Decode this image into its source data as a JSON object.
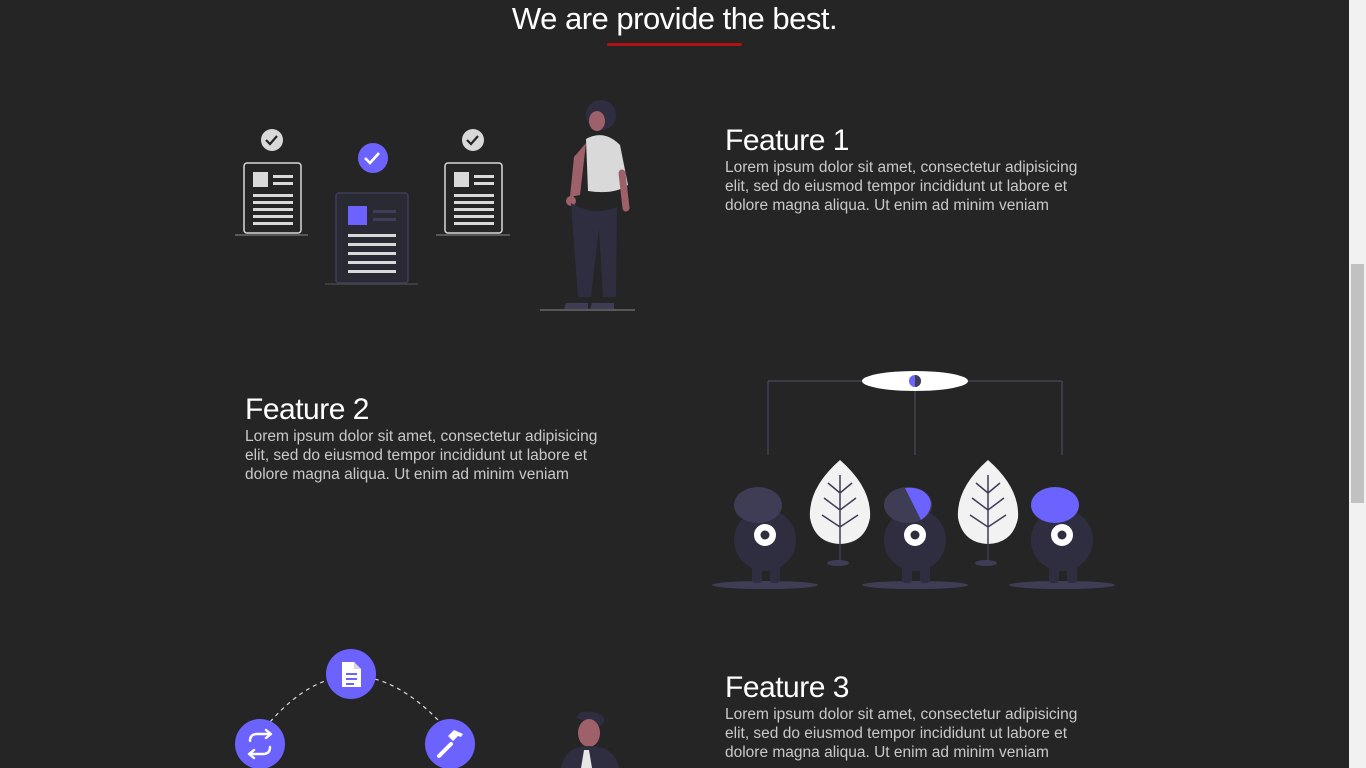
{
  "section": {
    "title": "We are provide the best."
  },
  "features": [
    {
      "title": "Feature 1",
      "body": "Lorem ipsum dolor sit amet, consectetur adipisicing elit, sed do eiusmod tempor incididunt ut labore et dolore magna aliqua. Ut enim ad minim veniam"
    },
    {
      "title": "Feature 2",
      "body": "Lorem ipsum dolor sit amet, consectetur adipisicing elit, sed do eiusmod tempor incididunt ut labore et dolore magna aliqua. Ut enim ad minim veniam"
    },
    {
      "title": "Feature 3",
      "body": "Lorem ipsum dolor sit amet, consectetur adipisicing elit, sed do eiusmod tempor incididunt ut labore et dolore magna aliqua. Ut enim ad minim veniam"
    }
  ],
  "colors": {
    "background": "#252525",
    "accent": "#6c63ff",
    "underline": "#b01212",
    "text": "#ffffff",
    "muted_text": "#c9c9c9"
  },
  "icons": {
    "illustration_1": "documents-checklist-person-illustration",
    "illustration_2": "hierarchy-creatures-trees-illustration",
    "illustration_3": "workflow-cycle-person-illustration"
  }
}
